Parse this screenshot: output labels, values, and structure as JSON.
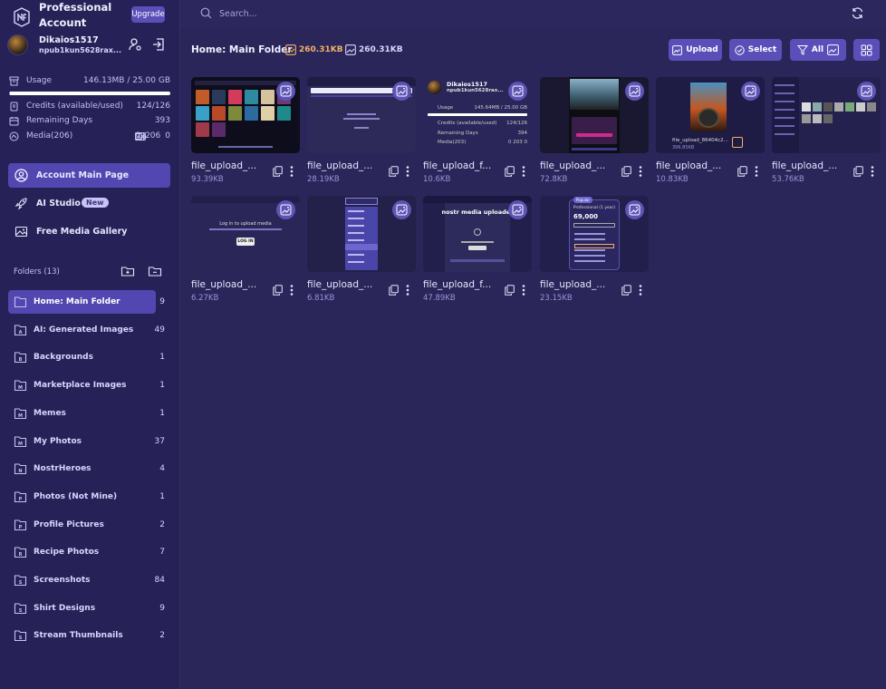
{
  "brand": {
    "title": "Professional Account",
    "upgrade_label": "Upgrade"
  },
  "user": {
    "name": "Dikaios1517",
    "npub": "npub1kun5628rax..."
  },
  "stats": {
    "usage_label": "Usage",
    "usage_value": "146.13MB / 25.00 GB",
    "usage_fraction": 0.006,
    "credits_label": "Credits (available/used)",
    "credits_value": "124/126",
    "days_label": "Remaining Days",
    "days_value": "393",
    "media_label": "Media(206)",
    "media_images": "0",
    "media_gifs": "206",
    "media_videos": "0"
  },
  "nav": [
    {
      "label": "Account Main Page",
      "icon": "user-circle-icon",
      "active": true
    },
    {
      "label": "AI Studio",
      "icon": "rocket-icon",
      "badge": "New"
    },
    {
      "label": "Free Media Gallery",
      "icon": "image-icon"
    }
  ],
  "folders_header": "Folders (13)",
  "folders": [
    {
      "label": "Home: Main Folder",
      "count": "9",
      "active": true,
      "letter": ""
    },
    {
      "label": "AI: Generated Images",
      "count": "49",
      "letter": "A"
    },
    {
      "label": "Backgrounds",
      "count": "1",
      "letter": "B"
    },
    {
      "label": "Marketplace Images",
      "count": "1",
      "letter": "M"
    },
    {
      "label": "Memes",
      "count": "1",
      "letter": "M"
    },
    {
      "label": "My Photos",
      "count": "37",
      "letter": "M"
    },
    {
      "label": "NostrHeroes",
      "count": "4",
      "letter": "N"
    },
    {
      "label": "Photos (Not Mine)",
      "count": "1",
      "letter": "P"
    },
    {
      "label": "Profile Pictures",
      "count": "2",
      "letter": "P"
    },
    {
      "label": "Recipe Photos",
      "count": "7",
      "letter": "R"
    },
    {
      "label": "Screenshots",
      "count": "84",
      "letter": "S"
    },
    {
      "label": "Shirt Designs",
      "count": "9",
      "letter": "S"
    },
    {
      "label": "Stream Thumbnails",
      "count": "2",
      "letter": "S"
    }
  ],
  "search": {
    "placeholder": "Search..."
  },
  "main": {
    "breadcrumb": "Home: Main Folder",
    "size_a": "260.31KB",
    "size_b": "260.31KB",
    "upload_label": "Upload",
    "select_label": "Select",
    "filter_label": "All"
  },
  "files": [
    {
      "name": "file_upload_...",
      "size": "93.39KB",
      "thumb": "gallery"
    },
    {
      "name": "file_upload_...",
      "size": "28.19KB",
      "thumb": "search-page"
    },
    {
      "name": "file_upload_f...",
      "size": "10.6KB",
      "thumb": "account-card"
    },
    {
      "name": "file_upload_...",
      "size": "72.8KB",
      "thumb": "phone-photo"
    },
    {
      "name": "file_upload_...",
      "size": "10.83KB",
      "thumb": "upload-preview"
    },
    {
      "name": "file_upload_...",
      "size": "53.76KB",
      "thumb": "dashboard"
    },
    {
      "name": "file_upload_...",
      "size": "6.27KB",
      "thumb": "login"
    },
    {
      "name": "file_upload_...",
      "size": "6.81KB",
      "thumb": "dropdown"
    },
    {
      "name": "file_upload_f...",
      "size": "47.89KB",
      "thumb": "uploader"
    },
    {
      "name": "file_upload_...",
      "size": "23.15KB",
      "thumb": "pricing"
    }
  ],
  "thumb_text": {
    "account_card_name": "Dikaios1517",
    "account_card_npub": "npub1kun5628rax...",
    "account_card_usage": "Usage",
    "account_card_usage_value": "145.64MB / 25.00 GB",
    "account_card_credits": "Credits (available/used)",
    "account_card_credits_value": "124/126",
    "account_card_days": "Remaining Days",
    "account_card_days_value": "394",
    "account_card_media": "Media(203)",
    "account_card_media_counts": "0 203 0",
    "upload_preview_name": "file_upload_86404c2...",
    "upload_preview_size": "396.85KB",
    "login_title": "Log in to upload media",
    "login_btn": "LOG IN",
    "uploader_title": "nostr media uploader",
    "pricing_tag": "Popular",
    "pricing_plan": "Professional (1 year)",
    "pricing_price": "69,000"
  },
  "colors": {
    "accent": "#5247b0",
    "orange": "#f3b168",
    "bg": "#2a2659"
  }
}
